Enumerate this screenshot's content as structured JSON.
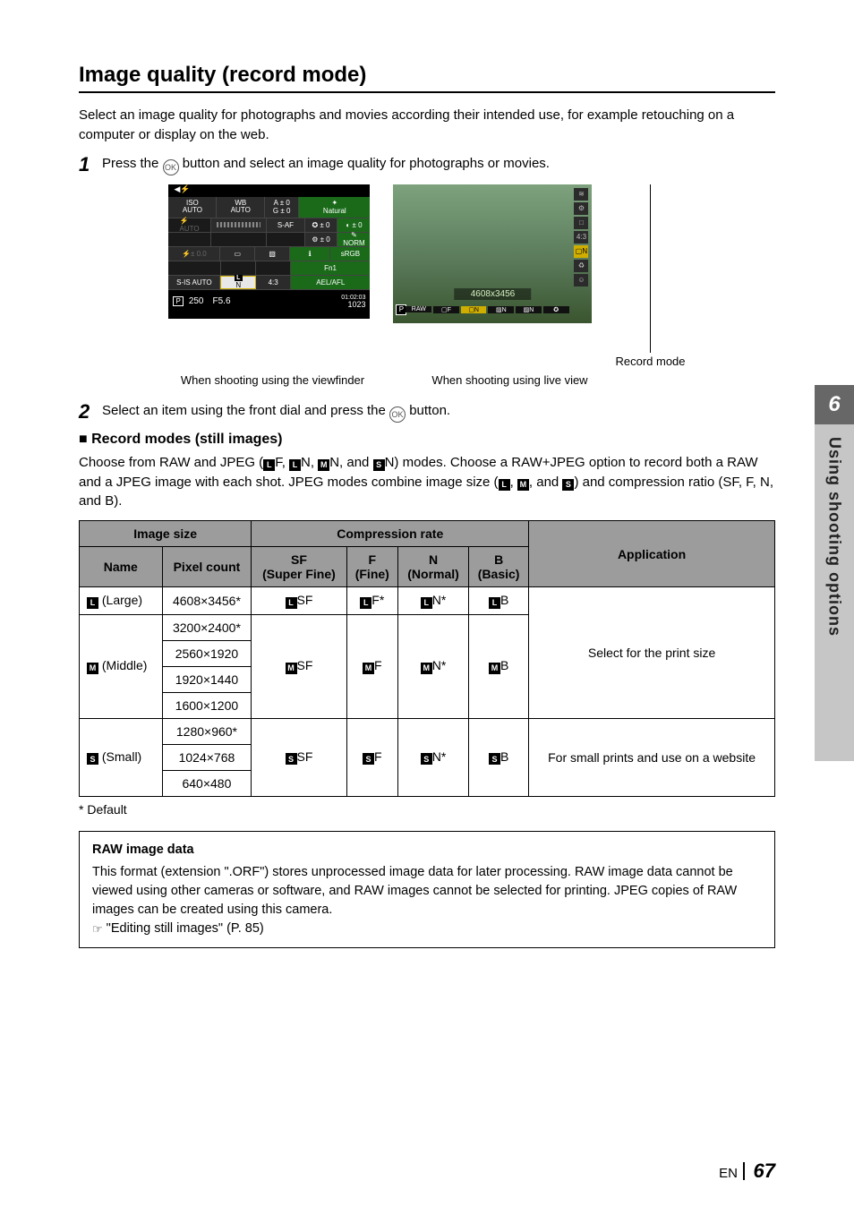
{
  "heading": "Image quality (record mode)",
  "intro": "Select an image quality for photographs and movies according their intended use, for example retouching on a computer or display on the web.",
  "step1_a": "Press the ",
  "step1_b": " button and select an image quality for photographs or movies.",
  "ok_label": "OK",
  "record_mode_arrow_label": "Record mode",
  "caption_vf": "When shooting using the viewfinder",
  "caption_lv": "When shooting using live view",
  "step2_a": "Select an item using the front dial and press the ",
  "step2_b": " button.",
  "subhead": "Record modes (still images)",
  "modes_intro_a": "Choose from RAW and JPEG (",
  "modes_intro_b": "F, ",
  "modes_intro_c": "N, ",
  "modes_intro_d": "N, and ",
  "modes_intro_e": "N) modes. Choose a RAW+JPEG option to record both a RAW and a JPEG image with each shot. JPEG modes combine image size (",
  "modes_intro_f": ", ",
  "modes_intro_g": ", and ",
  "modes_intro_h": ") and compression ratio (SF, F, N, and B).",
  "table": {
    "h_image_size": "Image size",
    "h_compression": "Compression rate",
    "h_application": "Application",
    "h_name": "Name",
    "h_pixel": "Pixel count",
    "h_sf": "SF\n(Super Fine)",
    "h_f": "F\n(Fine)",
    "h_n": "N\n(Normal)",
    "h_b": "B\n(Basic)",
    "rows": {
      "large_name": " (Large)",
      "large_px": "4608×3456*",
      "l_sf": "SF",
      "l_f": "F*",
      "l_n": "N*",
      "l_b": "B",
      "mid_name": " (Middle)",
      "m_px1": "3200×2400*",
      "m_px2": "2560×1920",
      "m_px3": "1920×1440",
      "m_px4": "1600×1200",
      "m_sf": "SF",
      "m_f": "F",
      "m_n": "N*",
      "m_b": "B",
      "sm_name": " (Small)",
      "s_px1": "1280×960*",
      "s_px2": "1024×768",
      "s_px3": "640×480",
      "s_sf": "SF",
      "s_f": "F",
      "s_n": "N*",
      "s_b": "B",
      "app_print": "Select for the print size",
      "app_web": "For small prints and use on a website"
    }
  },
  "default_note": "*  Default",
  "raw_title": "RAW image data",
  "raw_body": "This format (extension \".ORF\") stores unprocessed image data for later processing. RAW image data cannot be viewed using other cameras or software, and RAW images cannot be selected for printing. JPEG copies of RAW images can be created using this camera.",
  "raw_link": " \"Editing still images\" (P. 85)",
  "side_num": "6",
  "side_text": "Using shooting options",
  "footer_en": "EN",
  "footer_page": "67",
  "vf": {
    "iso": "ISO\nAUTO",
    "wb": "WB\nAUTO",
    "a0": "A ± 0",
    "g0": "G ± 0",
    "natural": "Natural",
    "s0": "✪ ± 0",
    "c0": "◐ ± 0",
    "ev": "⚙ ± 0",
    "norm": "NORM",
    "saf": "S-AF",
    "info": "ℹ",
    "srgb": "sRGB",
    "flash0": "⚡± 0.0",
    "sq": "▭",
    "card": "▧",
    "fn1": "Fn1",
    "sisauto": "S-IS AUTO",
    "ln": "▢N",
    "ratio": "4:3",
    "aelafl": "AEL/AFL",
    "p": "P",
    "shutter": "250",
    "fnum": "F5.6",
    "time": "01:02:03",
    "shots": "1023"
  },
  "lv": {
    "res_label": "4608x3456",
    "chips": [
      "RAW",
      "▢F",
      "▢N",
      "▨N",
      "▨N",
      "✪"
    ],
    "side_icons": [
      "≋",
      "⚙",
      "□",
      "4:3",
      "▢N",
      "♻",
      "☺"
    ]
  }
}
